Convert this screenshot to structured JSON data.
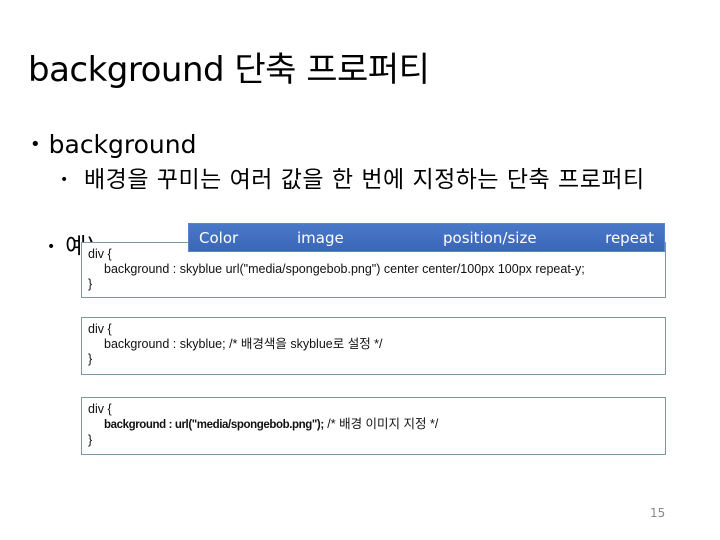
{
  "title": "background 단축 프로퍼티",
  "bullets": {
    "level1": "background",
    "level2": "배경을 꾸미는 여러 값을 한 번에 지정하는 단축 프로퍼티",
    "example_label": "예)"
  },
  "header_bar": {
    "labels": [
      "Color",
      "image",
      "position/size",
      "repeat"
    ],
    "color": "#3f6cbe"
  },
  "code_blocks": [
    {
      "open": "div {",
      "body": "background : skyblue url(\"media/spongebob.png\") center center/100px 100px repeat-y;",
      "close": "}"
    },
    {
      "open": "div {",
      "body": "background : skyblue; /* 배경색을 skyblue로 설정 */",
      "close": "}"
    },
    {
      "open": "div {",
      "body_bold": "background : url(\"media/spongebob.png\");",
      "body_comment": " /* 배경 이미지 지정 */",
      "close": "}"
    }
  ],
  "page_number": "15"
}
